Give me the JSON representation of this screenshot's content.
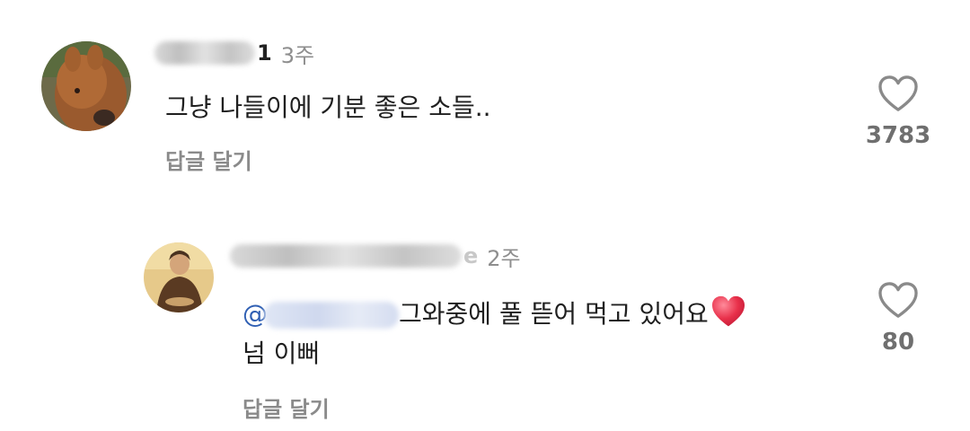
{
  "comments": [
    {
      "username_tail": "1",
      "time": "3주",
      "text": "그냥 나들이에 기분 좋은 소들..",
      "reply_label": "답글 달기",
      "like_count": "3783",
      "avatar_icon": "alpaca-photo-avatar",
      "like_icon": "heart-outline-icon"
    },
    {
      "username_tail": "e",
      "time": "2주",
      "mention_prefix": "@",
      "text_line1": "그와중에 풀 뜯어 먹고 있어요",
      "text_line2": "넘 이뻐",
      "emoji": "red-heart",
      "reply_label": "답글 달기",
      "like_count": "80",
      "avatar_icon": "person-photo-avatar",
      "like_icon": "heart-outline-icon"
    }
  ],
  "colors": {
    "mention": "#2f5fb3",
    "secondary_text": "#8e8e8e",
    "heart_emoji": "#e8304a"
  }
}
